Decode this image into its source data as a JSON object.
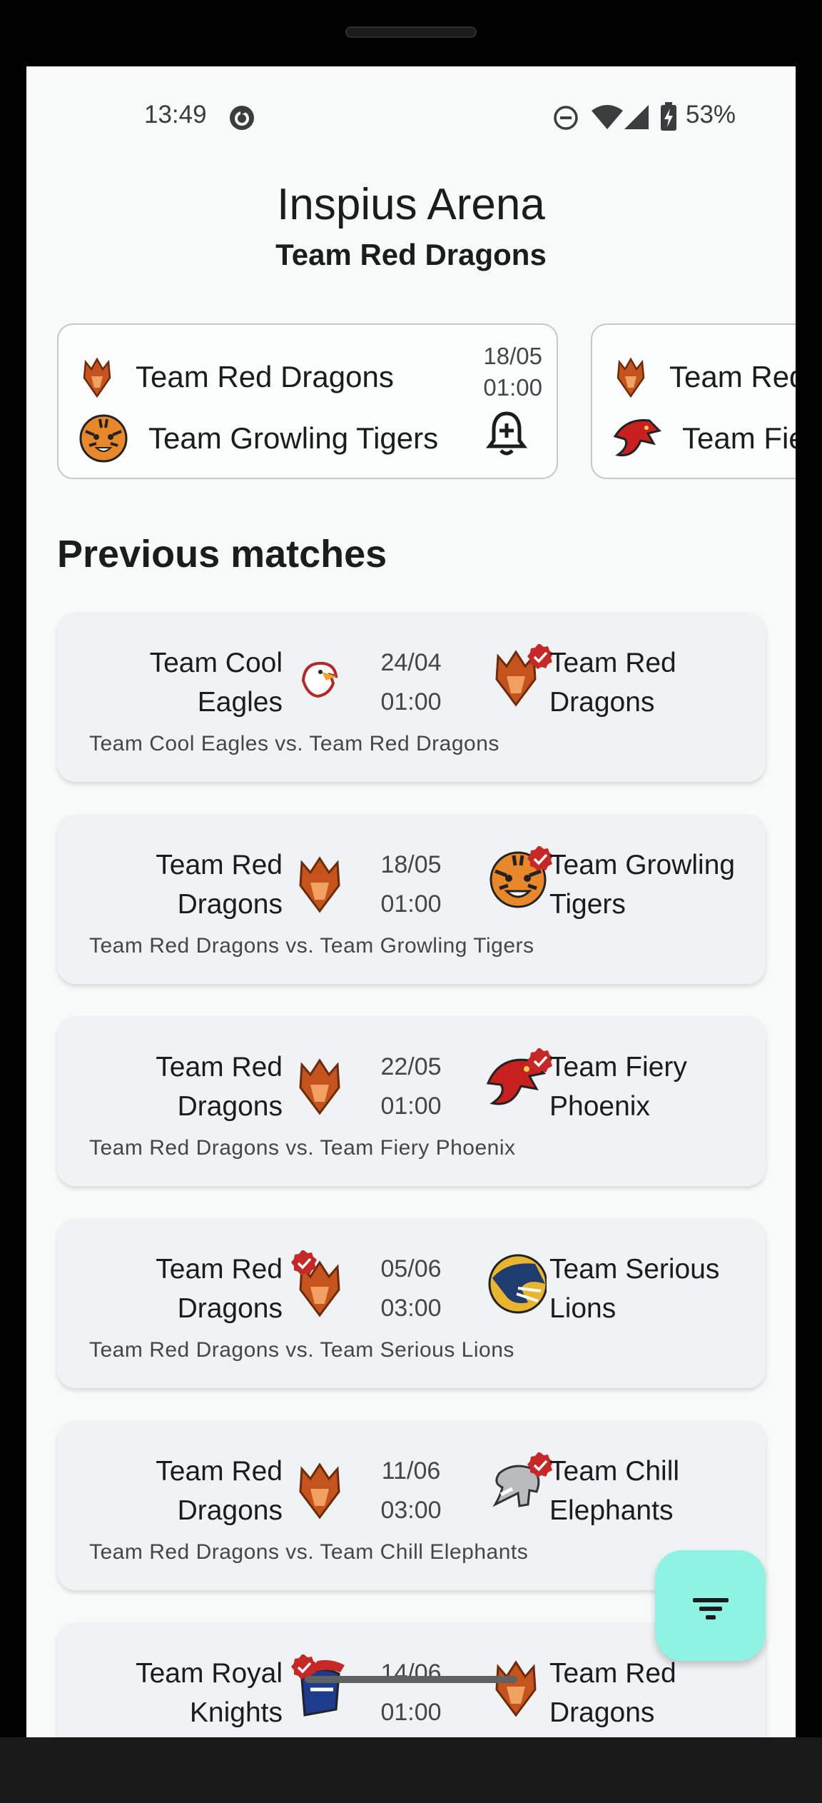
{
  "status_bar": {
    "time": "13:49",
    "battery": "53%",
    "icons": [
      "sync-icon",
      "do-not-disturb-icon",
      "wifi-icon",
      "cellular-icon",
      "battery-charging-icon"
    ]
  },
  "header": {
    "title": "Inspius Arena",
    "subtitle": "Team Red Dragons"
  },
  "upcoming": [
    {
      "team1": "Team Red Dragons",
      "team2": "Team Growling Tigers",
      "date": "18/05",
      "time": "01:00",
      "team1_logo": "dragon-logo",
      "team2_logo": "tiger-logo",
      "action_icon": "bell-plus-icon"
    },
    {
      "team1": "Team Red Dragons",
      "team2": "Team Fiery Phoenix",
      "team1_logo": "dragon-logo",
      "team2_logo": "phoenix-logo"
    }
  ],
  "section_title": "Previous matches",
  "matches": [
    {
      "home": "Team Cool Eagles",
      "away": "Team Red Dragons",
      "date": "24/04",
      "time": "01:00",
      "caption": "Team Cool Eagles vs. Team Red Dragons",
      "home_logo": "eagle-logo",
      "away_logo": "dragon-logo",
      "winner": "away"
    },
    {
      "home": "Team Red Dragons",
      "away": "Team Growling Tigers",
      "date": "18/05",
      "time": "01:00",
      "caption": "Team Red Dragons vs. Team Growling Tigers",
      "home_logo": "dragon-logo",
      "away_logo": "tiger-logo",
      "winner": "away"
    },
    {
      "home": "Team Red Dragons",
      "away": "Team Fiery Phoenix",
      "date": "22/05",
      "time": "01:00",
      "caption": "Team Red Dragons vs. Team Fiery Phoenix",
      "home_logo": "dragon-logo",
      "away_logo": "phoenix-logo",
      "winner": "away"
    },
    {
      "home": "Team Red Dragons",
      "away": "Team Serious Lions",
      "date": "05/06",
      "time": "03:00",
      "caption": "Team Red Dragons vs. Team Serious Lions",
      "home_logo": "dragon-logo",
      "away_logo": "lion-logo",
      "winner": "home"
    },
    {
      "home": "Team Red Dragons",
      "away": "Team Chill Elephants",
      "date": "11/06",
      "time": "03:00",
      "caption": "Team Red Dragons vs. Team Chill Elephants",
      "home_logo": "dragon-logo",
      "away_logo": "elephant-logo",
      "winner": "away"
    },
    {
      "home": "Team Royal Knights",
      "away": "Team Red Dragons",
      "date": "14/06",
      "time": "01:00",
      "caption": "",
      "home_logo": "knight-logo",
      "away_logo": "dragon-logo",
      "winner": "home"
    }
  ],
  "fab": {
    "icon": "filter-icon"
  },
  "colors": {
    "accent": "#8ef3e3",
    "card": "#eff3f3",
    "winner_badge": "#c62828"
  }
}
